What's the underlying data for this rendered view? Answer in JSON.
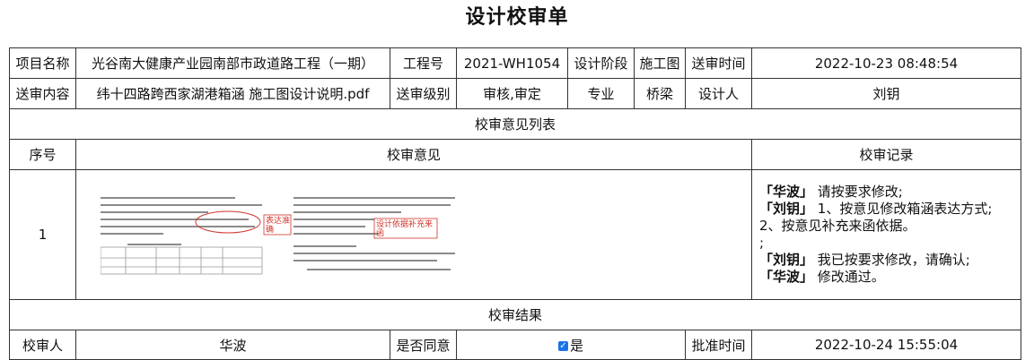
{
  "title": "设计校审单",
  "header": {
    "project_name_label": "项目名称",
    "project_name": "光谷南大健康产业园南部市政道路工程（一期）",
    "project_no_label": "工程号",
    "project_no": "2021-WH1054",
    "design_stage_label": "设计阶段",
    "design_stage": "施工图",
    "submit_time_label": "送审时间",
    "submit_time": "2022-10-23 08:48:54",
    "submit_content_label": "送审内容",
    "submit_content": "纬十四路跨西家湖港箱涵 施工图设计说明.pdf",
    "submit_level_label": "送审级别",
    "submit_level": "审核,审定",
    "discipline_label": "专业",
    "discipline": "桥梁",
    "designer_label": "设计人",
    "designer": "刘钥"
  },
  "opinions": {
    "section_title": "校审意见列表",
    "col_no": "序号",
    "col_opinion": "校审意见",
    "col_record": "校审记录",
    "rows": [
      {
        "no": "1",
        "snapshot_annotations": [
          "表达准确",
          "设计依据补充来函"
        ],
        "records": [
          {
            "name": "「华波」",
            "text": "请按要求修改;"
          },
          {
            "name": "「刘钥」",
            "text": "1、按意见修改箱涵表达方式;"
          },
          {
            "name": "",
            "text": "2、按意见补充来函依据。"
          },
          {
            "name": "",
            "text": ";"
          },
          {
            "name": "「刘钥」",
            "text": "我已按要求修改，请确认;"
          },
          {
            "name": "「华波」",
            "text": "修改通过。"
          }
        ]
      }
    ]
  },
  "result": {
    "section_title": "校审结果",
    "reviewer_label": "校审人",
    "reviewer": "华波",
    "agree_label": "是否同意",
    "agree_option": "是",
    "agree_checked": true,
    "approve_time_label": "批准时间",
    "approve_time": "2022-10-24 15:55:04"
  },
  "colors": {
    "annotation": "#d0342c",
    "checkbox": "#1a73e8",
    "border": "#333333"
  }
}
